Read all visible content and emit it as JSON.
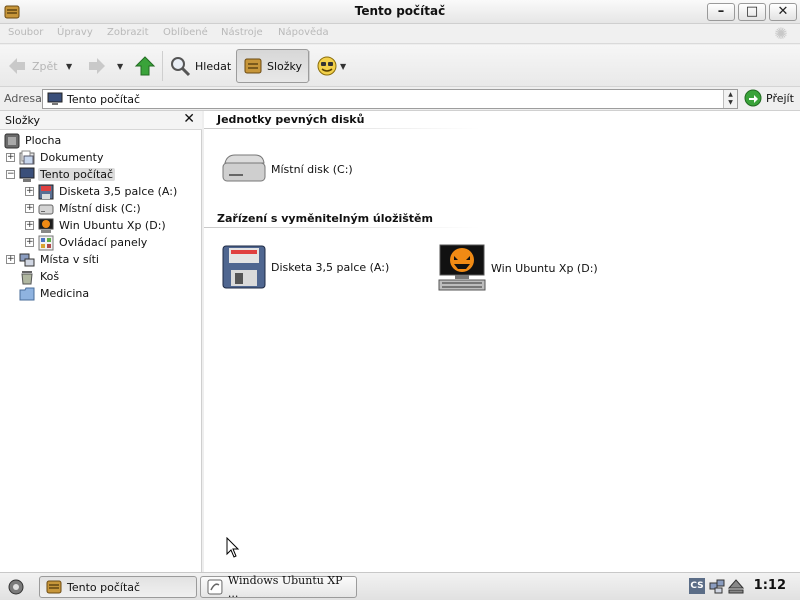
{
  "window": {
    "title": "Tento počítač"
  },
  "menu": [
    "Soubor",
    "Úpravy",
    "Zobrazit",
    "Oblíbené",
    "Nástroje",
    "Nápověda"
  ],
  "toolbar": {
    "back_label": "Zpět",
    "search_label": "Hledat",
    "folders_label": "Složky"
  },
  "address": {
    "label": "Adresa",
    "value": "Tento počítač",
    "go_label": "Přejít"
  },
  "sidebar": {
    "title": "Složky",
    "items": [
      {
        "label": "Plocha"
      },
      {
        "label": "Dokumenty"
      },
      {
        "label": "Tento počítač"
      },
      {
        "label": "Disketa 3,5 palce (A:)"
      },
      {
        "label": "Místní disk (C:)"
      },
      {
        "label": "Win Ubuntu Xp (D:)"
      },
      {
        "label": "Ovládací panely"
      },
      {
        "label": "Místa v síti"
      },
      {
        "label": "Koš"
      },
      {
        "label": "Medicina"
      }
    ]
  },
  "main": {
    "groups": [
      {
        "title": "Jednotky pevných disků",
        "items": [
          {
            "label": "Místní disk (C:)"
          }
        ]
      },
      {
        "title": "Zařízení s vyměnitelným úložištěm",
        "items": [
          {
            "label": "Disketa 3,5 palce (A:)"
          },
          {
            "label": "Win Ubuntu Xp (D:)"
          }
        ]
      }
    ]
  },
  "taskbar": {
    "tasks": [
      {
        "label": "Tento počítač"
      },
      {
        "label": "Windows Ubuntu XP ..."
      }
    ],
    "tray_text": "CS",
    "clock": "1:12"
  },
  "colors": {
    "toolbar_arrow_green": "#3aa33a",
    "selected_row": "#dcdcdc"
  }
}
